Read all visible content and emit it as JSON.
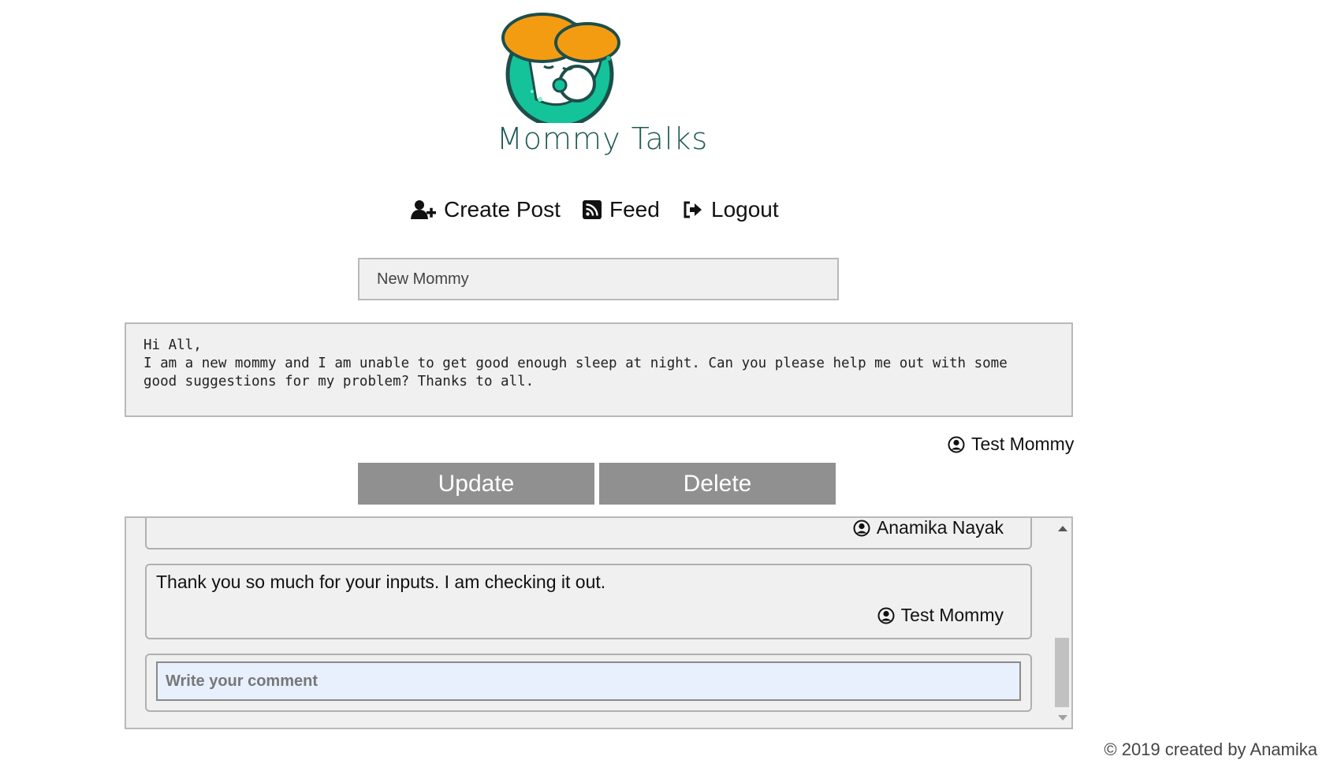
{
  "brand": {
    "name": "Mommy Talks"
  },
  "nav": {
    "create_post": "Create Post",
    "feed": "Feed",
    "logout": "Logout"
  },
  "post": {
    "title": "New Mommy",
    "body": "Hi All,\nI am a new mommy and I am unable to get good enough sleep at night. Can you please help me out with some\ngood suggestions for my problem? Thanks to all.",
    "author": "Test Mommy"
  },
  "actions": {
    "update": "Update",
    "delete": "Delete"
  },
  "comments": {
    "items": [
      {
        "text": "",
        "author": "Anamika Nayak"
      },
      {
        "text": "Thank you so much for your inputs. I am checking it out.",
        "author": "Test Mommy"
      }
    ],
    "input_placeholder": "Write your comment"
  },
  "footer": {
    "text": "© 2019 created by Anamika"
  },
  "colors": {
    "accent_orange": "#f39c12",
    "accent_teal": "#1abc9c",
    "button_gray": "#909090"
  }
}
